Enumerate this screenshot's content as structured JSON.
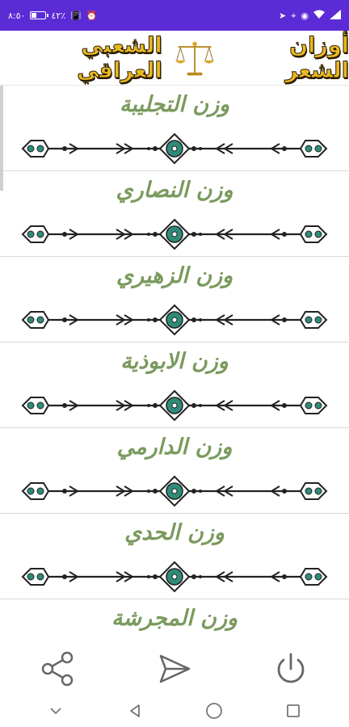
{
  "status_bar": {
    "time": "٨:٥٠",
    "battery_level": 0.42,
    "battery_text": "٤٢٪",
    "left_icons": [
      "battery-icon",
      "vibrate-icon",
      "alarm-icon"
    ],
    "right_icons": [
      "send-icon",
      "location-icon",
      "hotspot-icon",
      "wifi-icon",
      "signal-icon"
    ]
  },
  "header": {
    "title_part_1": "أوزان الشعر",
    "title_part_2": "الشعبي العراقي",
    "emblem_icon": "scales-of-justice-icon",
    "title_color": "#e8b923"
  },
  "list": {
    "items": [
      {
        "label": "وزن التجليبة"
      },
      {
        "label": "وزن النصاري"
      },
      {
        "label": "وزن الزهيري"
      },
      {
        "label": "وزن الابوذية"
      },
      {
        "label": "وزن الدارمي"
      },
      {
        "label": "وزن الحدي"
      },
      {
        "label": "وزن المجرشة"
      }
    ],
    "label_color": "#7a9a5e",
    "ornament_color": "#2e8b7a"
  },
  "toolbar": {
    "share_icon": "share-icon",
    "send_icon": "send-icon",
    "power_icon": "power-icon"
  },
  "nav_bar": {
    "buttons": [
      "hide-nav-icon",
      "back-icon",
      "home-icon",
      "recents-icon"
    ]
  }
}
